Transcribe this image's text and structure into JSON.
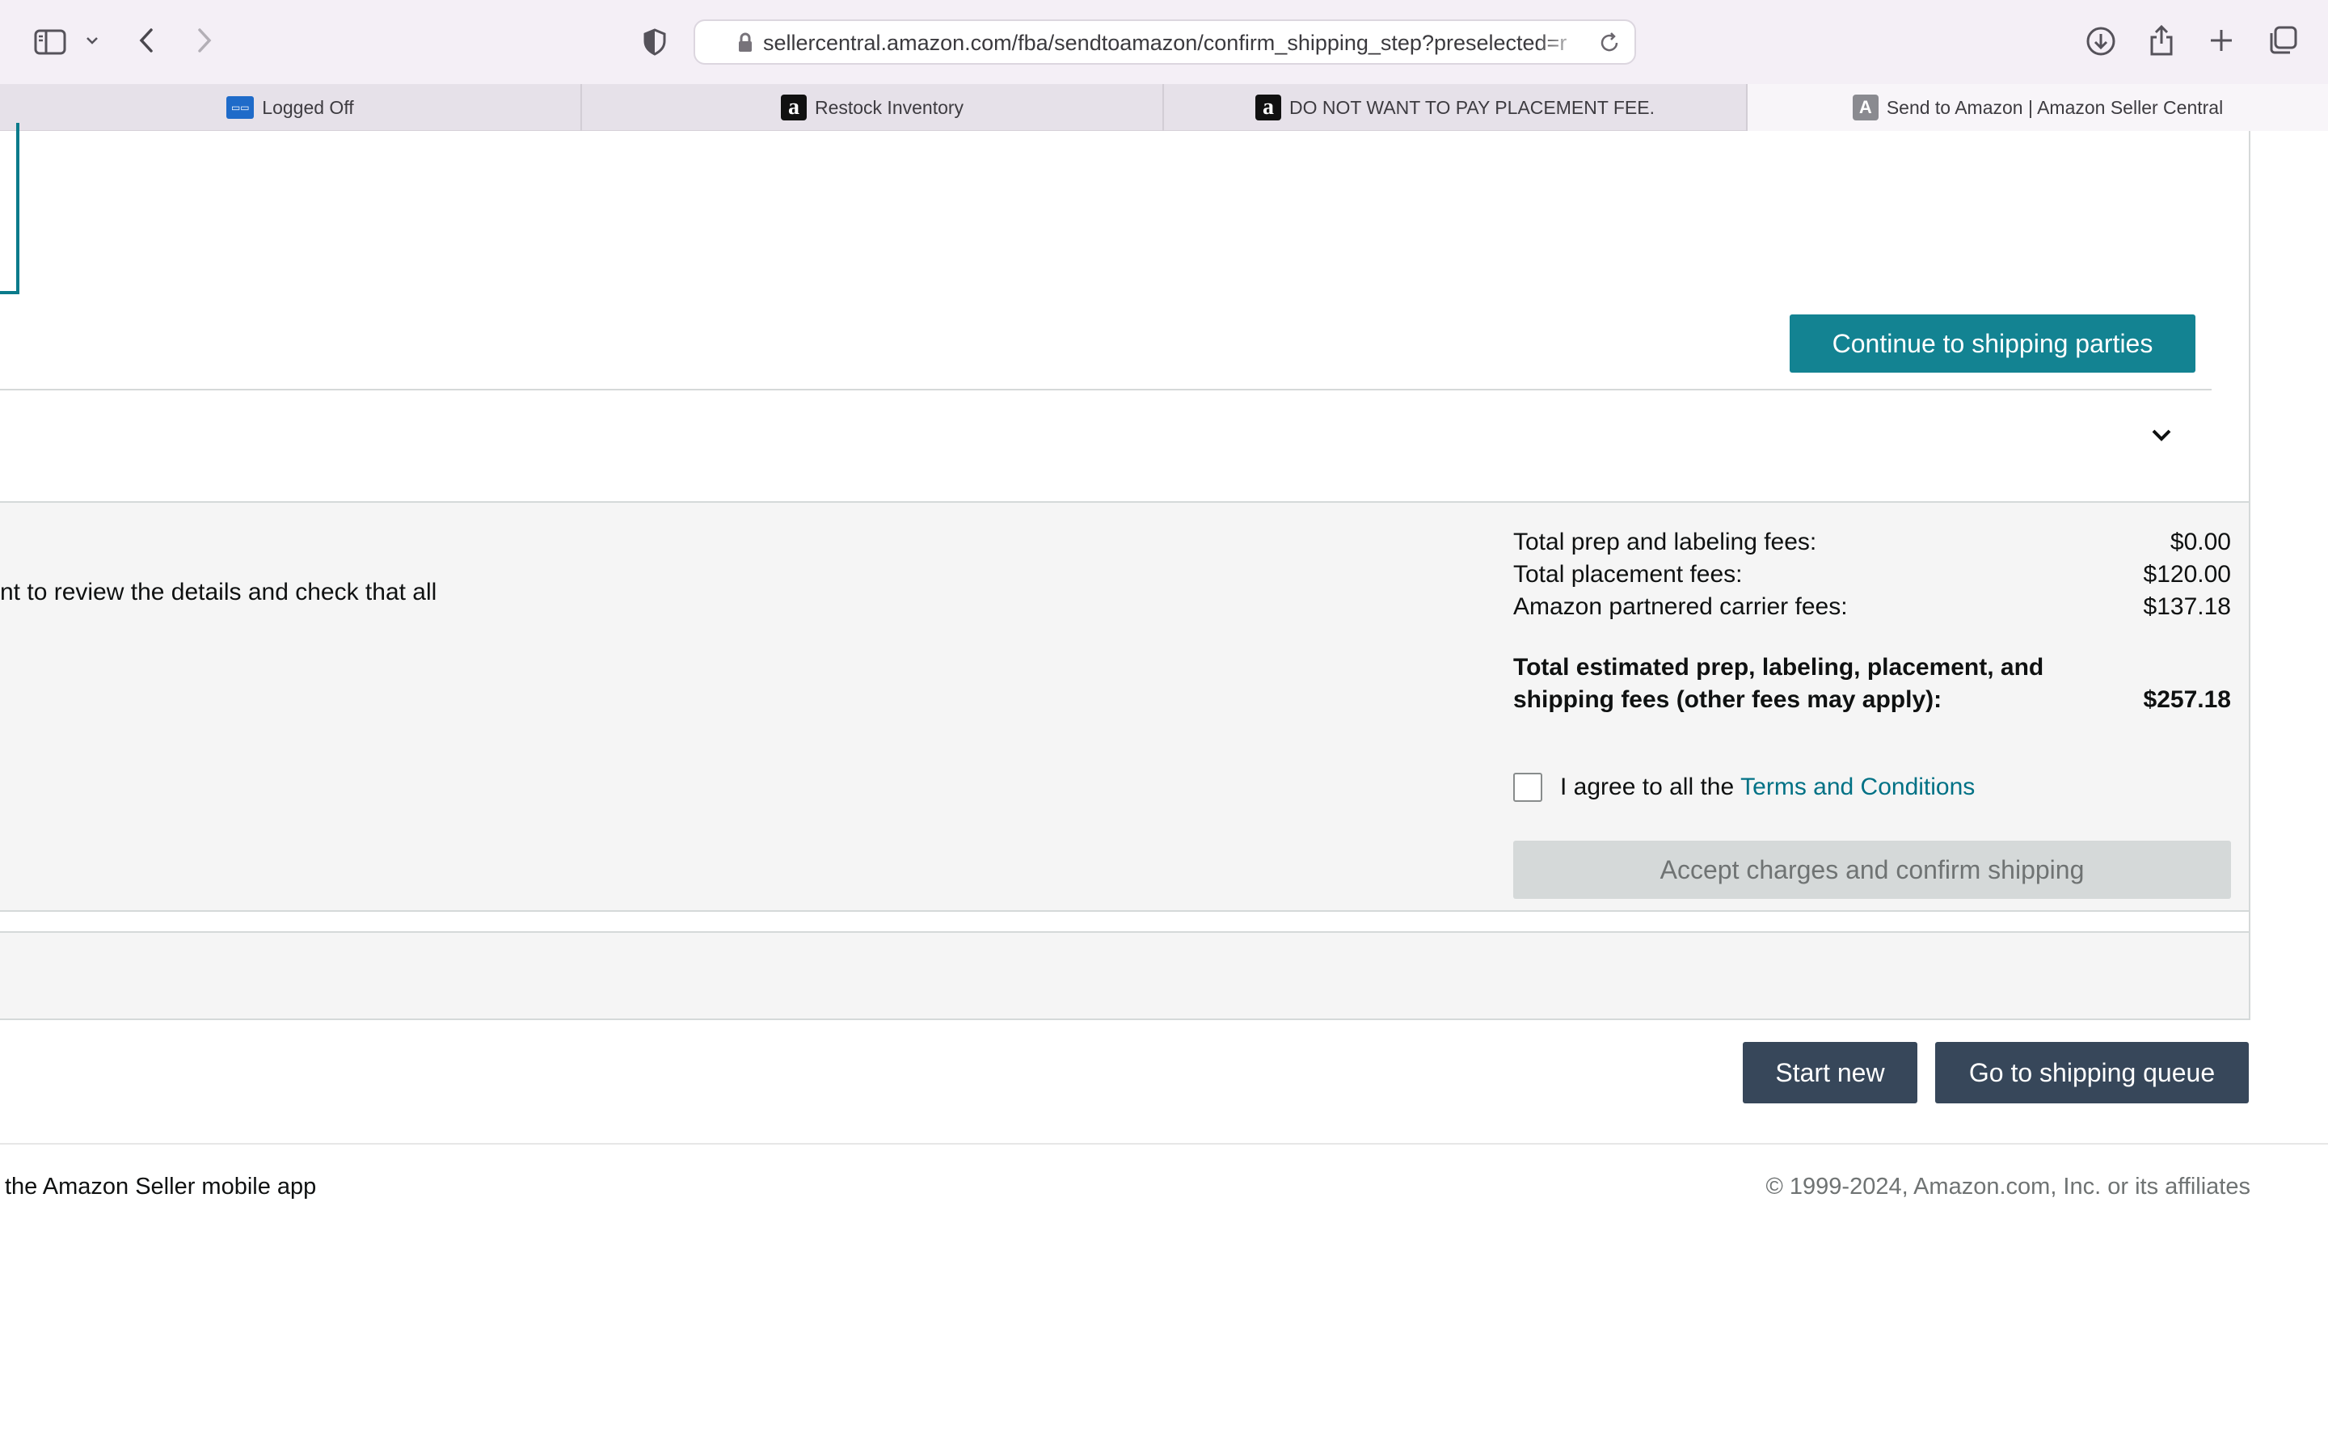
{
  "browser": {
    "url": "sellercentral.amazon.com/fba/sendtoamazon/confirm_shipping_step?preselected=r",
    "tabs": [
      {
        "label": "Logged Off",
        "favicon": "amex-icon",
        "active": false
      },
      {
        "label": "Restock Inventory",
        "favicon": "amazon-icon",
        "active": false
      },
      {
        "label": "DO NOT WANT TO PAY PLACEMENT FEE.",
        "favicon": "amazon-icon",
        "active": false
      },
      {
        "label": "Send to Amazon | Amazon Seller Central",
        "favicon": "seller-central-icon",
        "active": true
      }
    ]
  },
  "main": {
    "continue_button": "Continue to shipping parties",
    "review_text": "nt to review the details and check that all",
    "fees": [
      {
        "label": "Total prep and labeling fees:",
        "amount": "$0.00"
      },
      {
        "label": "Total placement fees:",
        "amount": "$120.00"
      },
      {
        "label": "Amazon partnered carrier fees:",
        "amount": "$137.18"
      }
    ],
    "total_label": "Total estimated prep, labeling, placement, and shipping fees (other fees may apply):",
    "total_amount": "$257.18",
    "agree_text": "I agree to all the",
    "terms_link": "Terms and Conditions",
    "accept_button": "Accept charges and confirm shipping",
    "start_new_button": "Start new",
    "shipping_queue_button": "Go to shipping queue"
  },
  "footer": {
    "app_text": "the Amazon Seller mobile app",
    "copyright": "© 1999-2024, Amazon.com, Inc. or its affiliates"
  },
  "colors": {
    "accent_teal": "#138392",
    "link": "#007185",
    "dark_button": "#37475a",
    "disabled_button": "#d5d9d9"
  }
}
